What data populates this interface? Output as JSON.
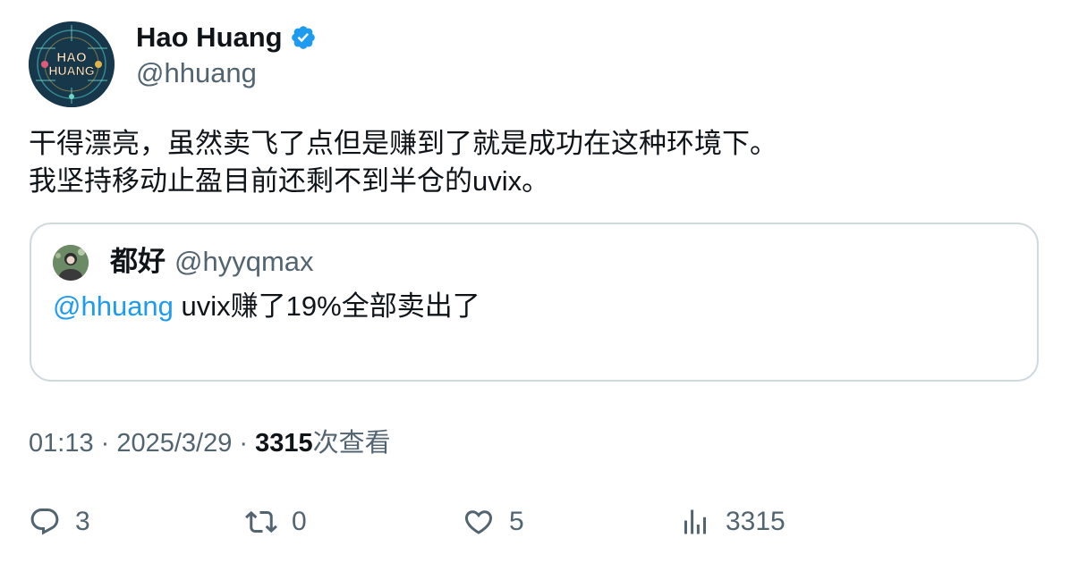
{
  "author": {
    "avatar_text_line1": "HAO",
    "avatar_text_line2": "HUANG",
    "display_name": "Hao Huang",
    "handle": "@hhuang",
    "verified_icon": "verified-badge-icon"
  },
  "tweet": {
    "line1": "干得漂亮，虽然卖飞了点但是赚到了就是成功在这种环境下。",
    "line2": "我坚持移动止盈目前还剩不到半仓的uvix。"
  },
  "quote": {
    "display_name": "都好",
    "handle": "@hyyqmax",
    "mention": "@hhuang",
    "text": " uvix赚了19%全部卖出了"
  },
  "meta": {
    "time": "01:13",
    "separator1": " · ",
    "date": "2025/3/29",
    "separator2": " · ",
    "views_count": "3315",
    "views_label": "次查看"
  },
  "actions": {
    "reply_count": "3",
    "retweet_count": "0",
    "like_count": "5",
    "views_count": "3315"
  },
  "colors": {
    "accent": "#1d9bf0",
    "secondary_text": "#536471",
    "primary_text": "#0f1419",
    "border": "#cfd9de"
  }
}
